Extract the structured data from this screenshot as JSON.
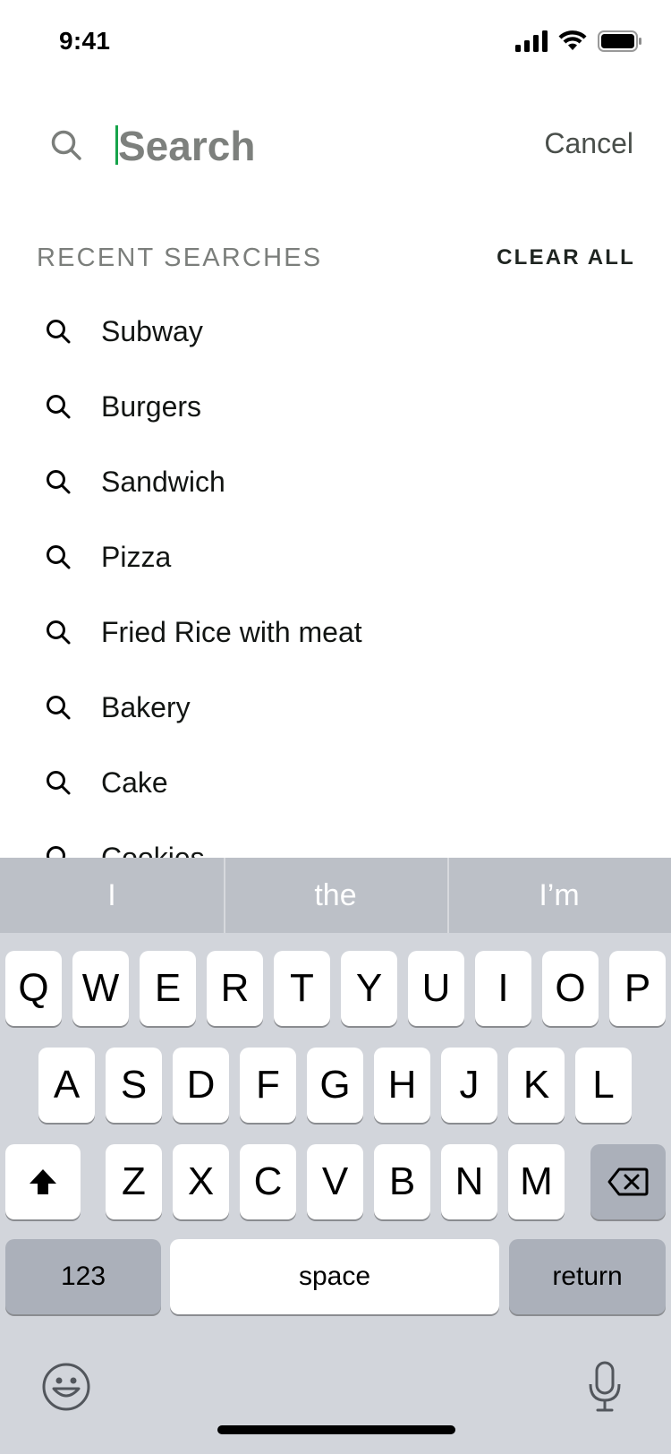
{
  "status_bar": {
    "time": "9:41"
  },
  "search": {
    "placeholder": "Search",
    "value": "",
    "cancel_label": "Cancel"
  },
  "recent": {
    "title": "RECENT SEARCHES",
    "clear_label": "CLEAR ALL",
    "items": [
      {
        "label": "Subway"
      },
      {
        "label": "Burgers"
      },
      {
        "label": "Sandwich"
      },
      {
        "label": "Pizza"
      },
      {
        "label": "Fried Rice with meat"
      },
      {
        "label": "Bakery"
      },
      {
        "label": "Cake"
      },
      {
        "label": "Cookies"
      }
    ]
  },
  "keyboard": {
    "suggestions": [
      "I",
      "the",
      "I’m"
    ],
    "row1": [
      "Q",
      "W",
      "E",
      "R",
      "T",
      "Y",
      "U",
      "I",
      "O",
      "P"
    ],
    "row2": [
      "A",
      "S",
      "D",
      "F",
      "G",
      "H",
      "J",
      "K",
      "L"
    ],
    "row3": [
      "Z",
      "X",
      "C",
      "V",
      "B",
      "N",
      "M"
    ],
    "numbers_label": "123",
    "space_label": "space",
    "return_label": "return",
    "icons": {
      "shift": "shift-icon",
      "backspace": "backspace-icon",
      "emoji": "emoji-icon",
      "mic": "microphone-icon"
    }
  },
  "colors": {
    "caret": "#16a34a",
    "placeholder": "#7d807d",
    "keyboard_bg": "#d2d5db"
  }
}
